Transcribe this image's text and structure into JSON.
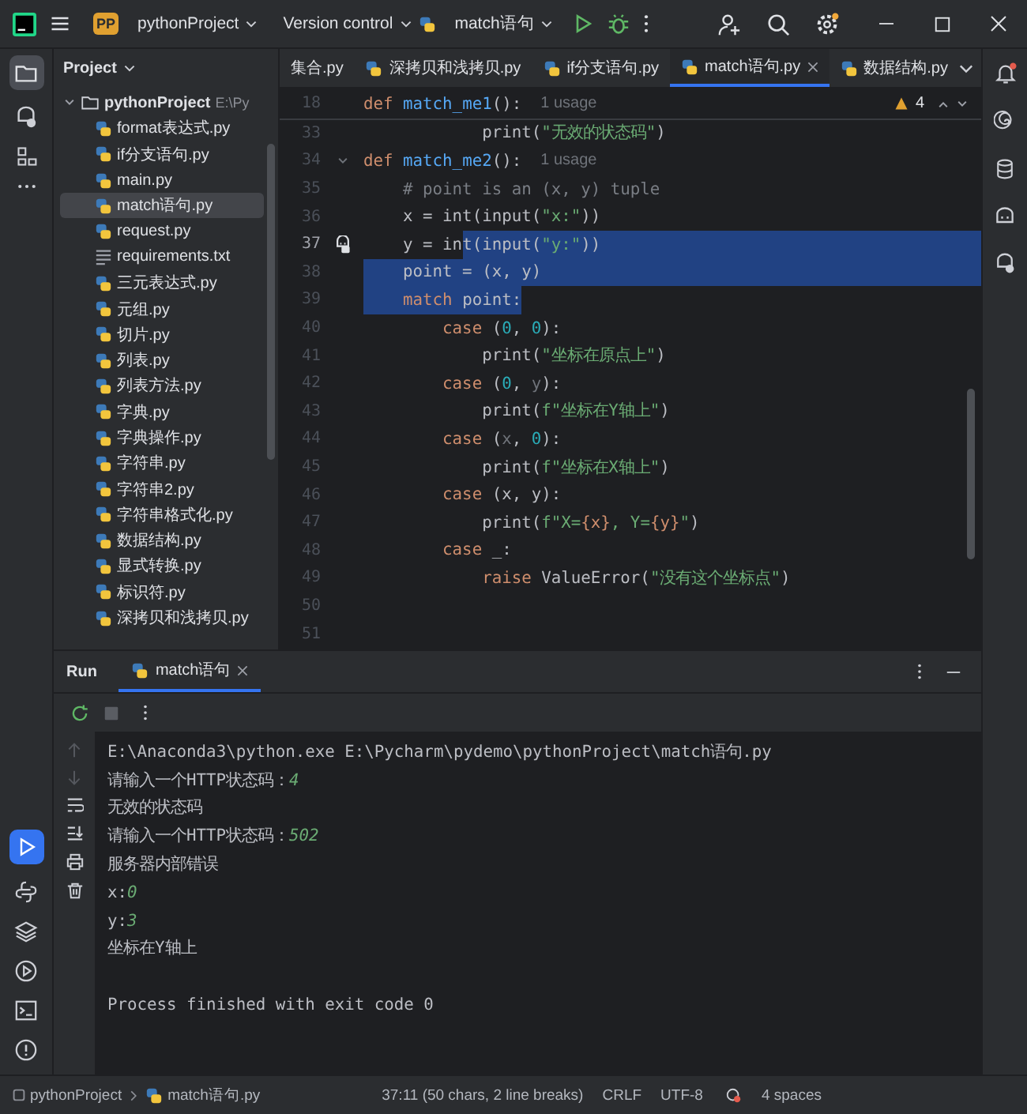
{
  "title_bar": {
    "project_badge": "PP",
    "project": "pythonProject",
    "vcs": "Version control",
    "run_config": "match语句"
  },
  "left_strip": {
    "project": {
      "selected": true
    },
    "run": {
      "selected": true
    }
  },
  "project_panel": {
    "title": "Project",
    "root": {
      "name": "pythonProject",
      "path": "E:\\Py",
      "expanded": true,
      "children": [
        {
          "name": "format表达式.py",
          "kind": "py",
          "selected": false
        },
        {
          "name": "if分支语句.py",
          "kind": "py",
          "selected": false
        },
        {
          "name": "main.py",
          "kind": "py",
          "selected": false
        },
        {
          "name": "match语句.py",
          "kind": "py",
          "selected": true
        },
        {
          "name": "request.py",
          "kind": "py",
          "selected": false
        },
        {
          "name": "requirements.txt",
          "kind": "txt",
          "selected": false
        },
        {
          "name": "三元表达式.py",
          "kind": "py",
          "selected": false
        },
        {
          "name": "元组.py",
          "kind": "py",
          "selected": false
        },
        {
          "name": "切片.py",
          "kind": "py",
          "selected": false
        },
        {
          "name": "列表.py",
          "kind": "py",
          "selected": false
        },
        {
          "name": "列表方法.py",
          "kind": "py",
          "selected": false
        },
        {
          "name": "字典.py",
          "kind": "py",
          "selected": false
        },
        {
          "name": "字典操作.py",
          "kind": "py",
          "selected": false
        },
        {
          "name": "字符串.py",
          "kind": "py",
          "selected": false
        },
        {
          "name": "字符串2.py",
          "kind": "py",
          "selected": false
        },
        {
          "name": "字符串格式化.py",
          "kind": "py",
          "selected": false
        },
        {
          "name": "数据结构.py",
          "kind": "py",
          "selected": false
        },
        {
          "name": "显式转换.py",
          "kind": "py",
          "selected": false
        },
        {
          "name": "标识符.py",
          "kind": "py",
          "selected": false
        },
        {
          "name": "深拷贝和浅拷贝.py",
          "kind": "py",
          "selected": false
        }
      ]
    }
  },
  "editor": {
    "tabs": [
      {
        "label": "集合.py",
        "has_icon": false,
        "selected": false
      },
      {
        "label": "深拷贝和浅拷贝.py",
        "has_icon": true,
        "selected": false
      },
      {
        "label": "if分支语句.py",
        "has_icon": true,
        "selected": false
      },
      {
        "label": "match语句.py",
        "has_icon": true,
        "selected": true
      },
      {
        "label": "数据结构.py",
        "has_icon": true,
        "selected": false
      }
    ],
    "warnings": "4",
    "lines": [
      {
        "number": "18",
        "sticky": true,
        "fold": false,
        "current": false,
        "selected_to_end": false,
        "hint": "1 usage",
        "tokens": [
          {
            "text": "def ",
            "kind": "kw",
            "selected": false
          },
          {
            "text": "match_me1",
            "kind": "fn",
            "selected": false
          },
          {
            "text": "():",
            "kind": "plain",
            "selected": false
          }
        ]
      },
      {
        "number": "33",
        "sticky": false,
        "fold": false,
        "current": false,
        "selected_to_end": false,
        "tokens": [
          {
            "text": "            print(",
            "kind": "plain",
            "selected": false
          },
          {
            "text": "\"无效的状态码\"",
            "kind": "str",
            "selected": false
          },
          {
            "text": ")",
            "kind": "plain",
            "selected": false
          }
        ]
      },
      {
        "number": "34",
        "sticky": false,
        "fold": true,
        "current": false,
        "selected_to_end": false,
        "hint": "1 usage",
        "tokens": [
          {
            "text": "def ",
            "kind": "kw",
            "selected": false
          },
          {
            "text": "match_me2",
            "kind": "fn",
            "selected": false
          },
          {
            "text": "():",
            "kind": "plain",
            "selected": false
          }
        ]
      },
      {
        "number": "35",
        "sticky": false,
        "fold": false,
        "current": false,
        "selected_to_end": false,
        "tokens": [
          {
            "text": "    # point is an (x, y) tuple",
            "kind": "cmt",
            "selected": false
          }
        ]
      },
      {
        "number": "36",
        "sticky": false,
        "fold": false,
        "current": false,
        "selected_to_end": false,
        "tokens": [
          {
            "text": "    x = int(input(",
            "kind": "plain",
            "selected": false
          },
          {
            "text": "\"x:\"",
            "kind": "str",
            "selected": false
          },
          {
            "text": "))",
            "kind": "plain",
            "selected": false
          }
        ]
      },
      {
        "number": "37",
        "sticky": false,
        "fold": false,
        "current": true,
        "selected_to_end": true,
        "tokens": [
          {
            "text": "    y = in",
            "kind": "plain",
            "selected": false
          },
          {
            "text": "t(input(",
            "kind": "plain",
            "selected": true
          },
          {
            "text": "\"y:\"",
            "kind": "str",
            "selected": true
          },
          {
            "text": "))",
            "kind": "plain",
            "selected": true
          }
        ]
      },
      {
        "number": "38",
        "sticky": false,
        "fold": false,
        "current": false,
        "selected_to_end": true,
        "tokens": [
          {
            "text": "    point = (x, y)",
            "kind": "plain",
            "selected": true
          }
        ]
      },
      {
        "number": "39",
        "sticky": false,
        "fold": false,
        "current": false,
        "selected_to_end": false,
        "tokens": [
          {
            "text": "    match",
            "kind": "kw",
            "selected": true
          },
          {
            "text": " point:",
            "kind": "plain",
            "selected": true
          }
        ]
      },
      {
        "number": "40",
        "sticky": false,
        "fold": false,
        "current": false,
        "selected_to_end": false,
        "tokens": [
          {
            "text": "        case ",
            "kind": "kw",
            "selected": false
          },
          {
            "text": "(",
            "kind": "plain",
            "selected": false
          },
          {
            "text": "0",
            "kind": "num",
            "selected": false
          },
          {
            "text": ", ",
            "kind": "plain",
            "selected": false
          },
          {
            "text": "0",
            "kind": "num",
            "selected": false
          },
          {
            "text": "):",
            "kind": "plain",
            "selected": false
          }
        ]
      },
      {
        "number": "41",
        "sticky": false,
        "fold": false,
        "current": false,
        "selected_to_end": false,
        "tokens": [
          {
            "text": "            print(",
            "kind": "plain",
            "selected": false
          },
          {
            "text": "\"坐标在原点上\"",
            "kind": "str",
            "selected": false
          },
          {
            "text": ")",
            "kind": "plain",
            "selected": false
          }
        ]
      },
      {
        "number": "42",
        "sticky": false,
        "fold": false,
        "current": false,
        "selected_to_end": false,
        "tokens": [
          {
            "text": "        case ",
            "kind": "kw",
            "selected": false
          },
          {
            "text": "(",
            "kind": "plain",
            "selected": false
          },
          {
            "text": "0",
            "kind": "num",
            "selected": false
          },
          {
            "text": ", ",
            "kind": "plain",
            "selected": false
          },
          {
            "text": "y",
            "kind": "dim",
            "selected": false
          },
          {
            "text": "):",
            "kind": "plain",
            "selected": false
          }
        ]
      },
      {
        "number": "43",
        "sticky": false,
        "fold": false,
        "current": false,
        "selected_to_end": false,
        "tokens": [
          {
            "text": "            print(",
            "kind": "plain",
            "selected": false
          },
          {
            "text": "f\"坐标在Y轴上\"",
            "kind": "str",
            "selected": false
          },
          {
            "text": ")",
            "kind": "plain",
            "selected": false
          }
        ]
      },
      {
        "number": "44",
        "sticky": false,
        "fold": false,
        "current": false,
        "selected_to_end": false,
        "tokens": [
          {
            "text": "        case ",
            "kind": "kw",
            "selected": false
          },
          {
            "text": "(",
            "kind": "plain",
            "selected": false
          },
          {
            "text": "x",
            "kind": "dim",
            "selected": false
          },
          {
            "text": ", ",
            "kind": "plain",
            "selected": false
          },
          {
            "text": "0",
            "kind": "num",
            "selected": false
          },
          {
            "text": "):",
            "kind": "plain",
            "selected": false
          }
        ]
      },
      {
        "number": "45",
        "sticky": false,
        "fold": false,
        "current": false,
        "selected_to_end": false,
        "tokens": [
          {
            "text": "            print(",
            "kind": "plain",
            "selected": false
          },
          {
            "text": "f\"坐标在X轴上\"",
            "kind": "str",
            "selected": false
          },
          {
            "text": ")",
            "kind": "plain",
            "selected": false
          }
        ]
      },
      {
        "number": "46",
        "sticky": false,
        "fold": false,
        "current": false,
        "selected_to_end": false,
        "tokens": [
          {
            "text": "        case ",
            "kind": "kw",
            "selected": false
          },
          {
            "text": "(x, y):",
            "kind": "plain",
            "selected": false
          }
        ]
      },
      {
        "number": "47",
        "sticky": false,
        "fold": false,
        "current": false,
        "selected_to_end": false,
        "tokens": [
          {
            "text": "            print(",
            "kind": "plain",
            "selected": false
          },
          {
            "text": "f\"X=",
            "kind": "str",
            "selected": false
          },
          {
            "text": "{x}",
            "kind": "interp",
            "selected": false
          },
          {
            "text": ", Y=",
            "kind": "str",
            "selected": false
          },
          {
            "text": "{y}",
            "kind": "interp",
            "selected": false
          },
          {
            "text": "\"",
            "kind": "str",
            "selected": false
          },
          {
            "text": ")",
            "kind": "plain",
            "selected": false
          }
        ]
      },
      {
        "number": "48",
        "sticky": false,
        "fold": false,
        "current": false,
        "selected_to_end": false,
        "tokens": [
          {
            "text": "        case ",
            "kind": "kw",
            "selected": false
          },
          {
            "text": "_:",
            "kind": "plain",
            "selected": false
          }
        ]
      },
      {
        "number": "49",
        "sticky": false,
        "fold": false,
        "current": false,
        "selected_to_end": false,
        "tokens": [
          {
            "text": "            raise ",
            "kind": "kw",
            "selected": false
          },
          {
            "text": "ValueError(",
            "kind": "plain",
            "selected": false
          },
          {
            "text": "\"没有这个坐标点\"",
            "kind": "str",
            "selected": false
          },
          {
            "text": ")",
            "kind": "plain",
            "selected": false
          }
        ]
      },
      {
        "number": "50",
        "sticky": false,
        "fold": false,
        "current": false,
        "selected_to_end": false
      },
      {
        "number": "51",
        "sticky": false,
        "fold": false,
        "current": false,
        "selected_to_end": false
      }
    ]
  },
  "run_panel": {
    "title": "Run",
    "tabs": [
      {
        "label": "match语句",
        "selected": true
      }
    ],
    "console": [
      {
        "kind": "output",
        "segments": [
          {
            "text": "E:\\Anaconda3\\python.exe E:\\Pycharm\\pydemo\\pythonProject\\match语句.py",
            "kind": "plain"
          }
        ]
      },
      {
        "kind": "output",
        "segments": [
          {
            "text": "请输入一个HTTP状态码：",
            "kind": "plain"
          },
          {
            "text": "4",
            "kind": "input"
          }
        ]
      },
      {
        "kind": "output",
        "segments": [
          {
            "text": "无效的状态码",
            "kind": "plain"
          }
        ]
      },
      {
        "kind": "output",
        "segments": [
          {
            "text": "请输入一个HTTP状态码：",
            "kind": "plain"
          },
          {
            "text": "502",
            "kind": "input"
          }
        ]
      },
      {
        "kind": "output",
        "segments": [
          {
            "text": "服务器内部错误",
            "kind": "plain"
          }
        ]
      },
      {
        "kind": "output",
        "segments": [
          {
            "text": "x:",
            "kind": "plain"
          },
          {
            "text": "0",
            "kind": "input"
          }
        ]
      },
      {
        "kind": "output",
        "segments": [
          {
            "text": "y:",
            "kind": "plain"
          },
          {
            "text": "3",
            "kind": "input"
          }
        ]
      },
      {
        "kind": "output",
        "segments": [
          {
            "text": "坐标在Y轴上",
            "kind": "plain"
          }
        ]
      },
      {
        "kind": "exit",
        "segments": [
          {
            "text": "Process finished with exit code 0",
            "kind": "plain"
          }
        ]
      }
    ]
  },
  "status_bar": {
    "breadcrumbs": [
      "pythonProject",
      "match语句.py"
    ],
    "position": "37:11 (50 chars, 2 line breaks)",
    "line_separator": "CRLF",
    "encoding": "UTF-8",
    "indent": "4 spaces"
  }
}
